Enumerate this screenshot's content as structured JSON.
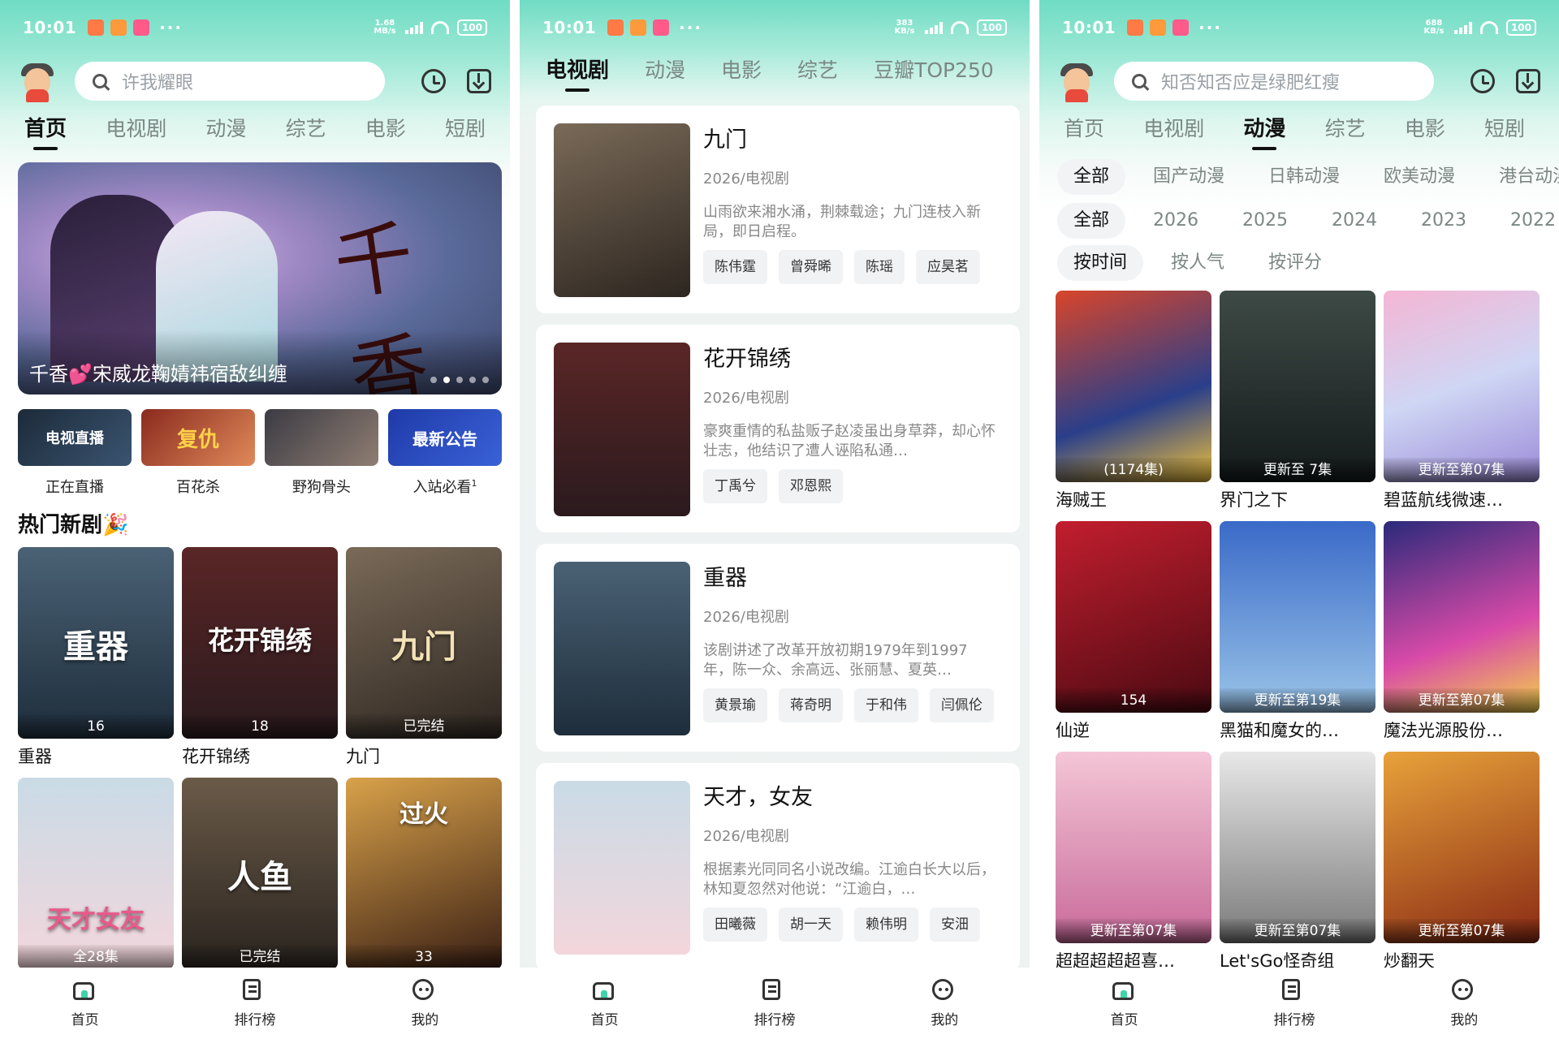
{
  "status": {
    "time": "10:01",
    "battery": "100",
    "netspeed_1": "1.68 MB/s",
    "netspeed_2": "383 KB/s",
    "netspeed_3": "688 KB/s",
    "dots": "···"
  },
  "panel1": {
    "search_placeholder": "许我耀眼",
    "tabs": [
      "首页",
      "电视剧",
      "动漫",
      "综艺",
      "电影",
      "短剧"
    ],
    "banner": {
      "caption": "千香💕宋威龙鞠婧祎宿敌纠缠",
      "art_text": "千香"
    },
    "quick": [
      {
        "label": "正在直播",
        "art": "电视直播"
      },
      {
        "label": "百花杀",
        "art": "复仇"
      },
      {
        "label": "野狗骨头",
        "art": ""
      },
      {
        "label": "入站必看",
        "art": "最新公告",
        "sup": "1"
      }
    ],
    "section_title": "热门新剧🎉",
    "cards": [
      {
        "name": "重器",
        "badge": "16",
        "art": "重器"
      },
      {
        "name": "花开锦绣",
        "badge": "18",
        "art": "花开锦绣"
      },
      {
        "name": "九门",
        "badge": "已完结",
        "art": "九门"
      },
      {
        "name": "",
        "badge": "全28集",
        "art": "天才女友"
      },
      {
        "name": "",
        "badge": "已完结",
        "art": "人鱼"
      },
      {
        "name": "",
        "badge": "33",
        "art": "过火"
      }
    ]
  },
  "panel2": {
    "tabs": [
      "电视剧",
      "动漫",
      "电影",
      "综艺",
      "豆瓣TOP250"
    ],
    "items": [
      {
        "title": "九门",
        "meta": "2026/电视剧",
        "desc": "山雨欲来湘水涌，荆棘载途；九门连枝入新局，即日启程。",
        "cast": [
          "陈伟霆",
          "曾舜晞",
          "陈瑶",
          "应昊茗"
        ],
        "art": "九门"
      },
      {
        "title": "花开锦绣",
        "meta": "2026/电视剧",
        "desc": "豪爽重情的私盐贩子赵凌虽出身草莽，却心怀壮志，他结识了遭人诬陷私通…",
        "cast": [
          "丁禹兮",
          "邓恩熙"
        ],
        "art": "花开锦绣"
      },
      {
        "title": "重器",
        "meta": "2026/电视剧",
        "desc": "该剧讲述了改革开放初期1979年到1997年，陈一众、余高远、张丽慧、夏英…",
        "cast": [
          "黄景瑜",
          "蒋奇明",
          "于和伟",
          "闫佩伦"
        ],
        "art": "重器"
      },
      {
        "title": "天才，女友",
        "meta": "2026/电视剧",
        "desc": "根据素光同同名小说改编。江逾白长大以后，林知夏忽然对他说：“江逾白，…",
        "cast": [
          "田曦薇",
          "胡一天",
          "赖伟明",
          "安沺"
        ],
        "art": "天才女友"
      }
    ]
  },
  "panel3": {
    "search_placeholder": "知否知否应是绿肥红瘦",
    "tabs": [
      "首页",
      "电视剧",
      "动漫",
      "综艺",
      "电影",
      "短剧"
    ],
    "filter_types": [
      "全部",
      "国产动漫",
      "日韩动漫",
      "欧美动漫",
      "港台动漫"
    ],
    "filter_years": [
      "全部",
      "2026",
      "2025",
      "2024",
      "2023",
      "2022"
    ],
    "filter_sort": [
      "按时间",
      "按人气",
      "按评分"
    ],
    "cards": [
      {
        "name": "海贼王",
        "badge": "(1174集)"
      },
      {
        "name": "界门之下",
        "badge": "更新至 7集"
      },
      {
        "name": "碧蓝航线微速…",
        "badge": "更新至第07集"
      },
      {
        "name": "仙逆",
        "badge": "154"
      },
      {
        "name": "黑猫和魔女的…",
        "badge": "更新至第19集"
      },
      {
        "name": "魔法光源股份…",
        "badge": "更新至第07集"
      },
      {
        "name": "超超超超超喜…",
        "badge": "更新至第07集"
      },
      {
        "name": "Let'sGo怪奇组",
        "badge": "更新至第07集"
      },
      {
        "name": "炒翻天",
        "badge": "更新至第07集"
      }
    ]
  },
  "bottomnav": {
    "home": "首页",
    "rank": "排行榜",
    "mine": "我的"
  },
  "colors": {
    "accent": "#3ed3a8",
    "header_gradient": "#6fdcc3"
  }
}
